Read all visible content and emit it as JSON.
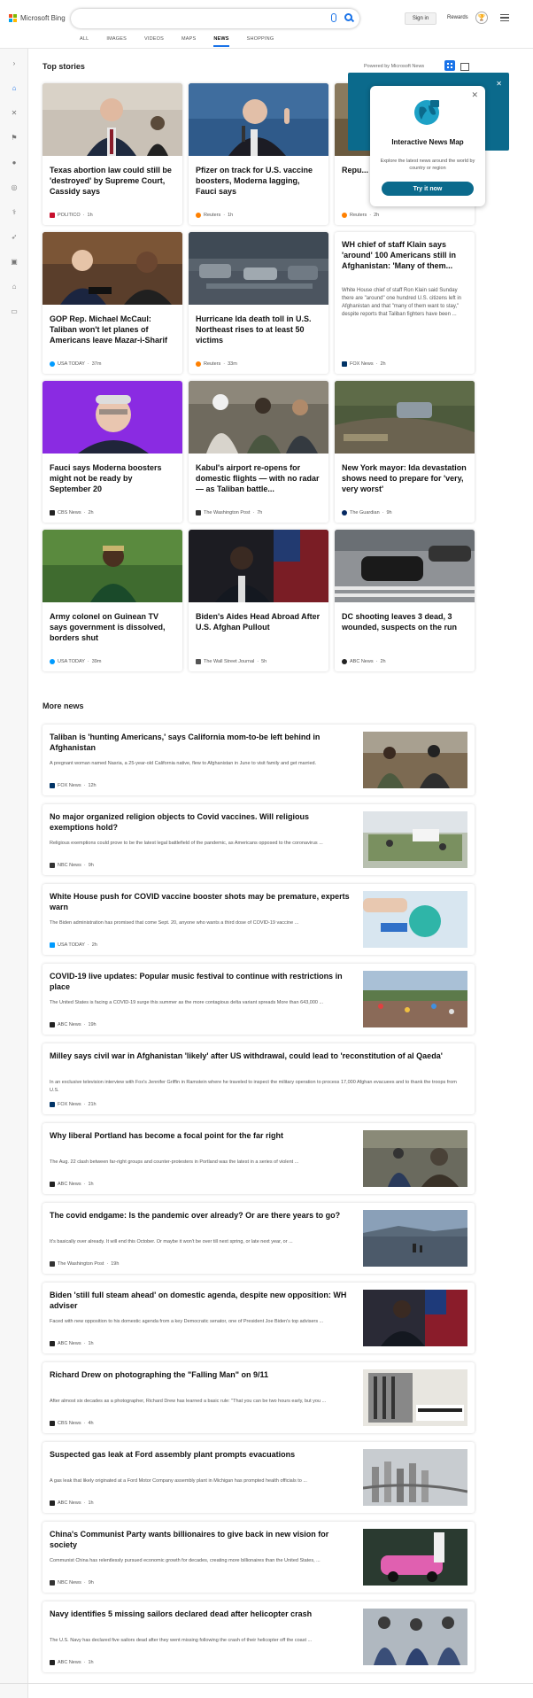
{
  "header": {
    "logo_text": "Microsoft Bing",
    "search_value": "",
    "signin_label": "Sign in",
    "rewards_label": "Rewards",
    "nav_tabs": [
      "ALL",
      "IMAGES",
      "VIDEOS",
      "MAPS",
      "NEWS",
      "SHOPPING"
    ],
    "active_tab": "NEWS"
  },
  "top_stories": {
    "title": "Top stories",
    "powered_by": "Powered by Microsoft News",
    "cards": [
      {
        "title": "Texas abortion law could still be 'destroyed' by Supreme Court, Cassidy says",
        "source": "POLITICO",
        "time": "1h",
        "color": "#c8102e"
      },
      {
        "title": "Pfizer on track for U.S. vaccine boosters, Moderna lagging, Fauci says",
        "source": "Reuters",
        "time": "1h",
        "color": "#ff8000"
      },
      {
        "title": "Repu... Hous... -Kinz...",
        "source": "Reuters",
        "time": "2h",
        "color": "#ff8000"
      },
      {
        "title": "GOP Rep. Michael McCaul: Taliban won't let planes of Americans leave Mazar-i-Sharif",
        "source": "USA TODAY",
        "time": "37m",
        "color": "#009bff"
      },
      {
        "title": "Hurricane Ida death toll in U.S. Northeast rises to at least 50 victims",
        "source": "Reuters",
        "time": "33m",
        "color": "#ff8000"
      },
      {
        "title": "WH chief of staff Klain says 'around' 100 Americans still in Afghanistan: 'Many of them...",
        "snippet": "White House chief of staff Ron Klain said Sunday there are \"around\" one hundred U.S. citizens left in Afghanistan and that \"many of them want to stay,\" despite reports that Taliban fighters have been ...",
        "source": "FOX News",
        "time": "2h",
        "color": "#003366"
      },
      {
        "title": "Fauci says Moderna boosters might not be ready by September 20",
        "source": "CBS News",
        "time": "2h",
        "color": "#222222"
      },
      {
        "title": "Kabul's airport re-opens for domestic flights — with no radar — as Taliban battle...",
        "source": "The Washington Post",
        "time": "7h",
        "color": "#333333"
      },
      {
        "title": "New York mayor: Ida devastation shows need to prepare for 'very, very worst'",
        "source": "The Guardian",
        "time": "9h",
        "color": "#052962"
      },
      {
        "title": "Army colonel on Guinean TV says government is dissolved, borders shut",
        "source": "USA TODAY",
        "time": "39m",
        "color": "#009bff"
      },
      {
        "title": "Biden's Aides Head Abroad After U.S. Afghan Pullout",
        "source": "The Wall Street Journal",
        "time": "5h",
        "color": "#555555"
      },
      {
        "title": "DC shooting leaves 3 dead, 3 wounded, suspects on the run",
        "source": "ABC News",
        "time": "2h",
        "color": "#222222"
      }
    ]
  },
  "popup": {
    "title": "Interactive News Map",
    "description": "Explore the latest news around the world by country or region",
    "button": "Try it now"
  },
  "more_news": {
    "title": "More news",
    "items": [
      {
        "title": "Taliban is 'hunting Americans,' says California mom-to-be left behind in Afghanistan",
        "snippet": "A pregnant woman named Nasria, a 25-year-old California native, flew to Afghanistan in June to visit family and get married.",
        "source": "FOX News",
        "time": "12h",
        "color": "#003366"
      },
      {
        "title": "No major organized religion objects to Covid vaccines. Will religious exemptions hold?",
        "snippet": "Religious exemptions could prove to be the latest legal battlefield of the pandemic, as Americans opposed to the coronavirus ...",
        "source": "NBC News",
        "time": "9h",
        "color": "#333333"
      },
      {
        "title": "White House push for COVID vaccine booster shots may be premature, experts warn",
        "snippet": "The Biden administration has promised that come Sept. 20, anyone who wants a third dose of COVID-19 vaccine ...",
        "source": "USA TODAY",
        "time": "2h",
        "color": "#009bff"
      },
      {
        "title": "COVID-19 live updates: Popular music festival to continue with restrictions in place",
        "snippet": "The United States is facing a COVID-19 surge this summer as the more contagious delta variant spreads More than 643,000 ...",
        "source": "ABC News",
        "time": "19h",
        "color": "#222222"
      },
      {
        "title": "Milley says civil war in Afghanistan 'likely' after US withdrawal, could lead to 'reconstitution of al Qaeda'",
        "snippet": "In an exclusive television interview with Fox's Jennifer Griffin in Ramstein where he traveled to inspect the military operation to process 17,000 Afghan evacuees and to thank the troops from U.S.",
        "source": "FOX News",
        "time": "21h",
        "color": "#003366"
      },
      {
        "title": "Why liberal Portland has become a focal point for the far right",
        "snippet": "The Aug. 22 clash between far-right groups and counter-protesters in Portland was the latest in a series of violent ...",
        "source": "ABC News",
        "time": "1h",
        "color": "#222222"
      },
      {
        "title": "The covid endgame: Is the pandemic over already? Or are there years to go?",
        "snippet": "It's basically over already. It will end this October. Or maybe it won't be over till next spring, or late next year, or ...",
        "source": "The Washington Post",
        "time": "19h",
        "color": "#333333"
      },
      {
        "title": "Biden 'still full steam ahead' on domestic agenda, despite new opposition: WH adviser",
        "snippet": "Faced with new opposition to his domestic agenda from a key Democratic senator, one of President Joe Biden's top advisers ...",
        "source": "ABC News",
        "time": "1h",
        "color": "#222222"
      },
      {
        "title": "Richard Drew on photographing the \"Falling Man\" on 9/11",
        "snippet": "After almost six decades as a photographer, Richard Drew has learned a basic rule: \"That you can be two hours early, but you ...",
        "source": "CBS News",
        "time": "4h",
        "color": "#222222"
      },
      {
        "title": "Suspected gas leak at Ford assembly plant prompts evacuations",
        "snippet": "A gas leak that likely originated at a Ford Motor Company assembly plant in Michigan has prompted health officials to ...",
        "source": "ABC News",
        "time": "1h",
        "color": "#222222"
      },
      {
        "title": "China's Communist Party wants billionaires to give back in new vision for society",
        "snippet": "Communist China has relentlessly pursued economic growth for decades, creating more billionaires than the United States, ...",
        "source": "NBC News",
        "time": "9h",
        "color": "#333333"
      },
      {
        "title": "Navy identifies 5 missing sailors declared dead after helicopter crash",
        "snippet": "The U.S. Navy has declared five sailors dead after they went missing following the crash of their helicopter off the coast ...",
        "source": "ABC News",
        "time": "1h",
        "color": "#222222"
      }
    ]
  }
}
